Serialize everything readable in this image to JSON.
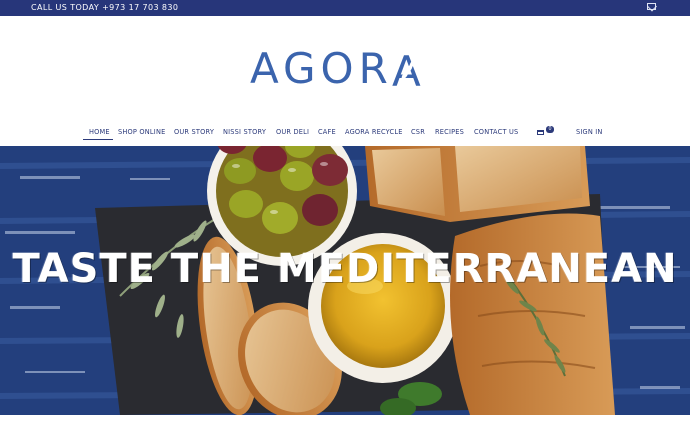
{
  "topbar": {
    "phone": "CALL US TODAY  +973 17 703 830",
    "mail_icon": "mail-icon"
  },
  "brand": {
    "logo_text": "AGOR",
    "logo_last_letter": "A",
    "color": "#3b64ad"
  },
  "nav": {
    "items": [
      {
        "label": "HOME"
      },
      {
        "label": "SHOP ONLINE"
      },
      {
        "label": "OUR STORY"
      },
      {
        "label": "NISSI STORY"
      },
      {
        "label": "OUR DELI"
      },
      {
        "label": "CAFE"
      },
      {
        "label": "AGORA RECYCLE"
      },
      {
        "label": "CSR"
      },
      {
        "label": "RECIPES"
      },
      {
        "label": "CONTACT US"
      }
    ],
    "active": "HOME",
    "cart_count": "0",
    "sign_in": "SIGN IN",
    "color": "#2c3a7a"
  },
  "hero": {
    "headline": "TASTE THE MEDITERRANEAN"
  }
}
